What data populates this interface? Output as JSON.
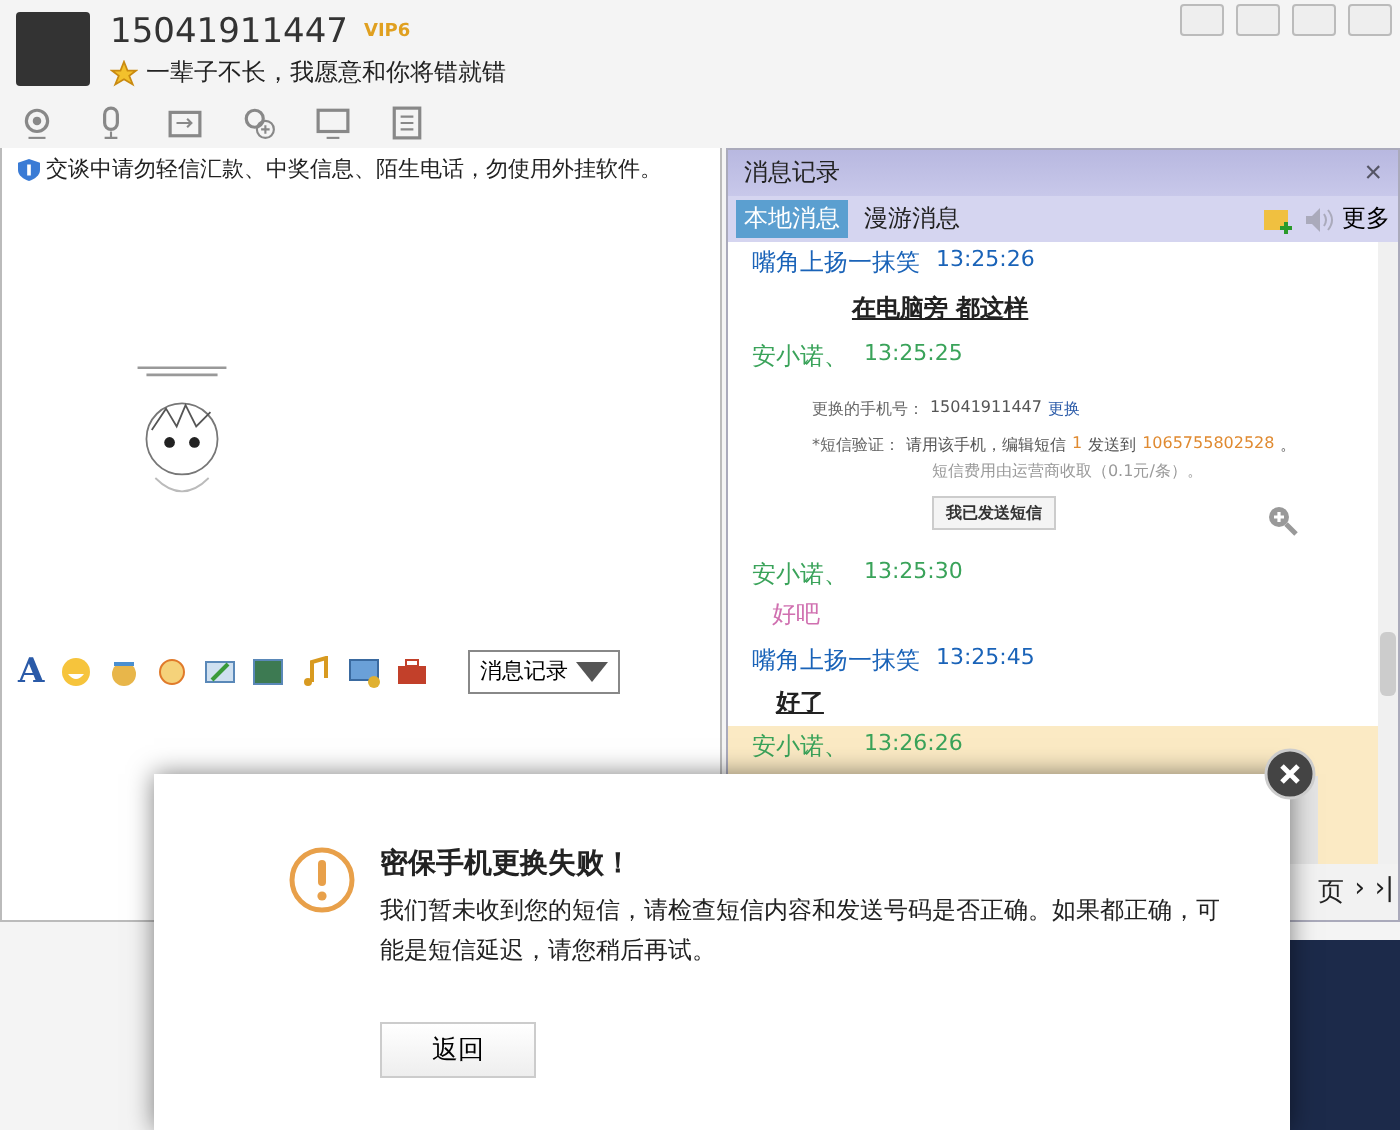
{
  "contact": {
    "name": "15041911447",
    "badge": "VIP6",
    "signature": "一辈子不长，我愿意和你将错就错"
  },
  "notice": "交谈中请勿轻信汇款、中奖信息、陌生电话，勿使用外挂软件。",
  "input_toolbar": {
    "font_button": "A",
    "history_button": "消息记录"
  },
  "history": {
    "title": "消息记录",
    "close": "×",
    "tabs": [
      {
        "label": "本地消息",
        "selected": true
      },
      {
        "label": "漫游消息",
        "selected": false
      }
    ],
    "more": "更多",
    "messages": [
      {
        "sender": "嘴角上扬一抹笑",
        "time": "13:25:26",
        "color": "#1a63b8",
        "selected": false,
        "kind": "emphasis",
        "text": "在电脑旁 都这样"
      },
      {
        "sender": "安小诺、",
        "time": "13:25:25",
        "color": "#3aa35a",
        "selected": false,
        "kind": "screenshot",
        "form": {
          "phone_label": "更换的手机号：",
          "phone": "15041911447",
          "change_link": "更换",
          "sms_label": "*短信验证：",
          "sms_text": "请用该手机，编辑短信",
          "sms_code": "1",
          "sms_to": "发送到",
          "sms_number": "1065755802528",
          "sms_end": "。",
          "fee_note": "短信费用由运营商收取（0.1元/条）。",
          "sent_button": "我已发送短信"
        }
      },
      {
        "sender": "安小诺、",
        "time": "13:25:30",
        "color": "#3aa35a",
        "selected": false,
        "kind": "soft",
        "text": "好吧"
      },
      {
        "sender": "嘴角上扬一抹笑",
        "time": "13:25:45",
        "color": "#1a63b8",
        "selected": false,
        "kind": "emphasis",
        "text": "好了"
      },
      {
        "sender": "安小诺、",
        "time": "13:26:26",
        "color": "#3aa35a",
        "selected": true,
        "kind": "thumbnail"
      }
    ],
    "pager": [
      "页",
      "›",
      "›|"
    ]
  },
  "dialog": {
    "title": "密保手机更换失败！",
    "message": "我们暂未收到您的短信，请检查短信内容和发送号码是否正确。如果都正确，可能是短信延迟，请您稍后再试。",
    "button": "返回"
  }
}
